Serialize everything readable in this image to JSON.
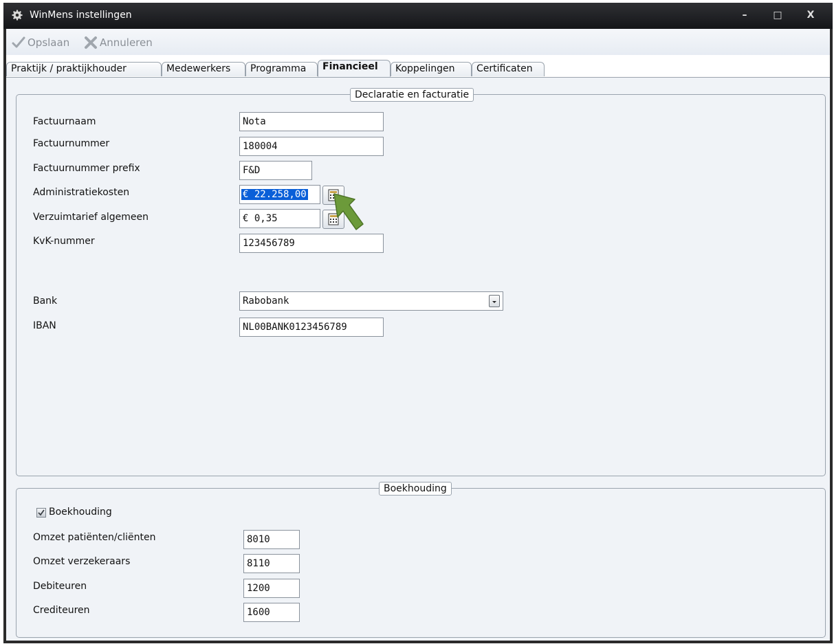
{
  "window": {
    "title": "WinMens instellingen",
    "minimize": "–",
    "maximize": "□",
    "close": "X"
  },
  "toolbar": {
    "save_label": "Opslaan",
    "cancel_label": "Annuleren"
  },
  "tabs": [
    {
      "label": "Praktijk / praktijkhouder"
    },
    {
      "label": "Medewerkers"
    },
    {
      "label": "Programma"
    },
    {
      "label": "Financieel",
      "active": true
    },
    {
      "label": "Koppelingen"
    },
    {
      "label": "Certificaten"
    }
  ],
  "declaratie": {
    "legend": "Declaratie en facturatie",
    "factuurnaam_label": "Factuurnaam",
    "factuurnaam_value": "Nota",
    "factuurnummer_label": "Factuurnummer",
    "factuurnummer_value": "180004",
    "prefix_label": "Factuurnummer prefix",
    "prefix_value": "F&D",
    "admin_label": "Administratiekosten",
    "admin_value": "€ 22.258,00",
    "verzuim_label": "Verzuimtarief algemeen",
    "verzuim_value": "€ 0,35",
    "kvk_label": "KvK-nummer",
    "kvk_value": "123456789",
    "bank_label": "Bank",
    "bank_value": "Rabobank",
    "iban_label": "IBAN",
    "iban_value": "NL00BANK0123456789"
  },
  "boekhouding": {
    "legend": "Boekhouding",
    "checkbox_label": "Boekhouding",
    "checked": true,
    "omzet_patient_label": "Omzet patiënten/cliënten",
    "omzet_patient_value": "8010",
    "omzet_verz_label": "Omzet verzekeraars",
    "omzet_verz_value": "8110",
    "debiteuren_label": "Debiteuren",
    "debiteuren_value": "1200",
    "crediteuren_label": "Crediteuren",
    "crediteuren_value": "1600"
  },
  "colors": {
    "accent_arrow": "#6c9a3a",
    "selection": "#0a5fd8",
    "panel": "#f0f3f7"
  },
  "icons": {
    "app": "gear-icon",
    "save": "checkmark-icon",
    "cancel": "cross-icon",
    "calculator": "calculator-icon",
    "pointer": "green-arrow-icon"
  }
}
